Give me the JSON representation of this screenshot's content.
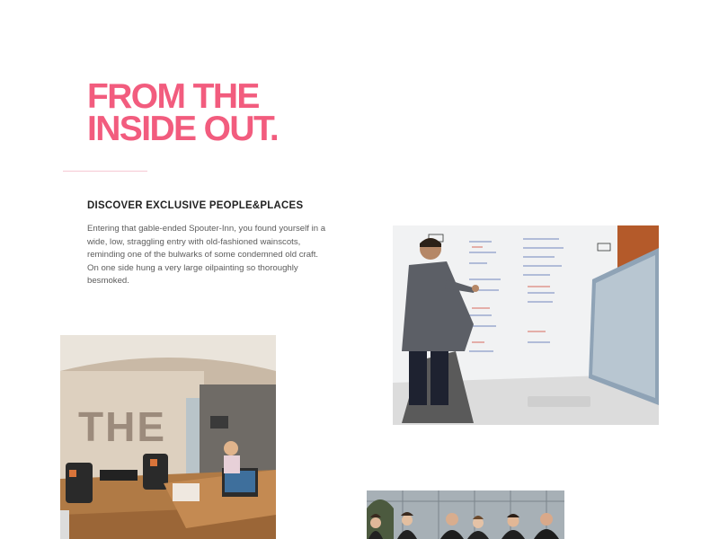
{
  "hero": {
    "headline_line1": "FROM THE",
    "headline_line2": "INSIDE OUT."
  },
  "intro": {
    "subheading": "DISCOVER EXCLUSIVE PEOPLE&PLACES",
    "body": "Entering that gable-ended Spouter-Inn, you found yourself in a wide, low, straggling entry with old-fashioned wainscots, reminding one of the bulwarks of some condemned old craft. On one side hung a very large oilpainting so thoroughly besmoked."
  },
  "gallery": {
    "office_wall_letters": "THE"
  },
  "colors": {
    "accent": "#f25c7e",
    "divider": "#f6c8d3",
    "heading": "#222222",
    "body_text": "#5c5c5c"
  }
}
